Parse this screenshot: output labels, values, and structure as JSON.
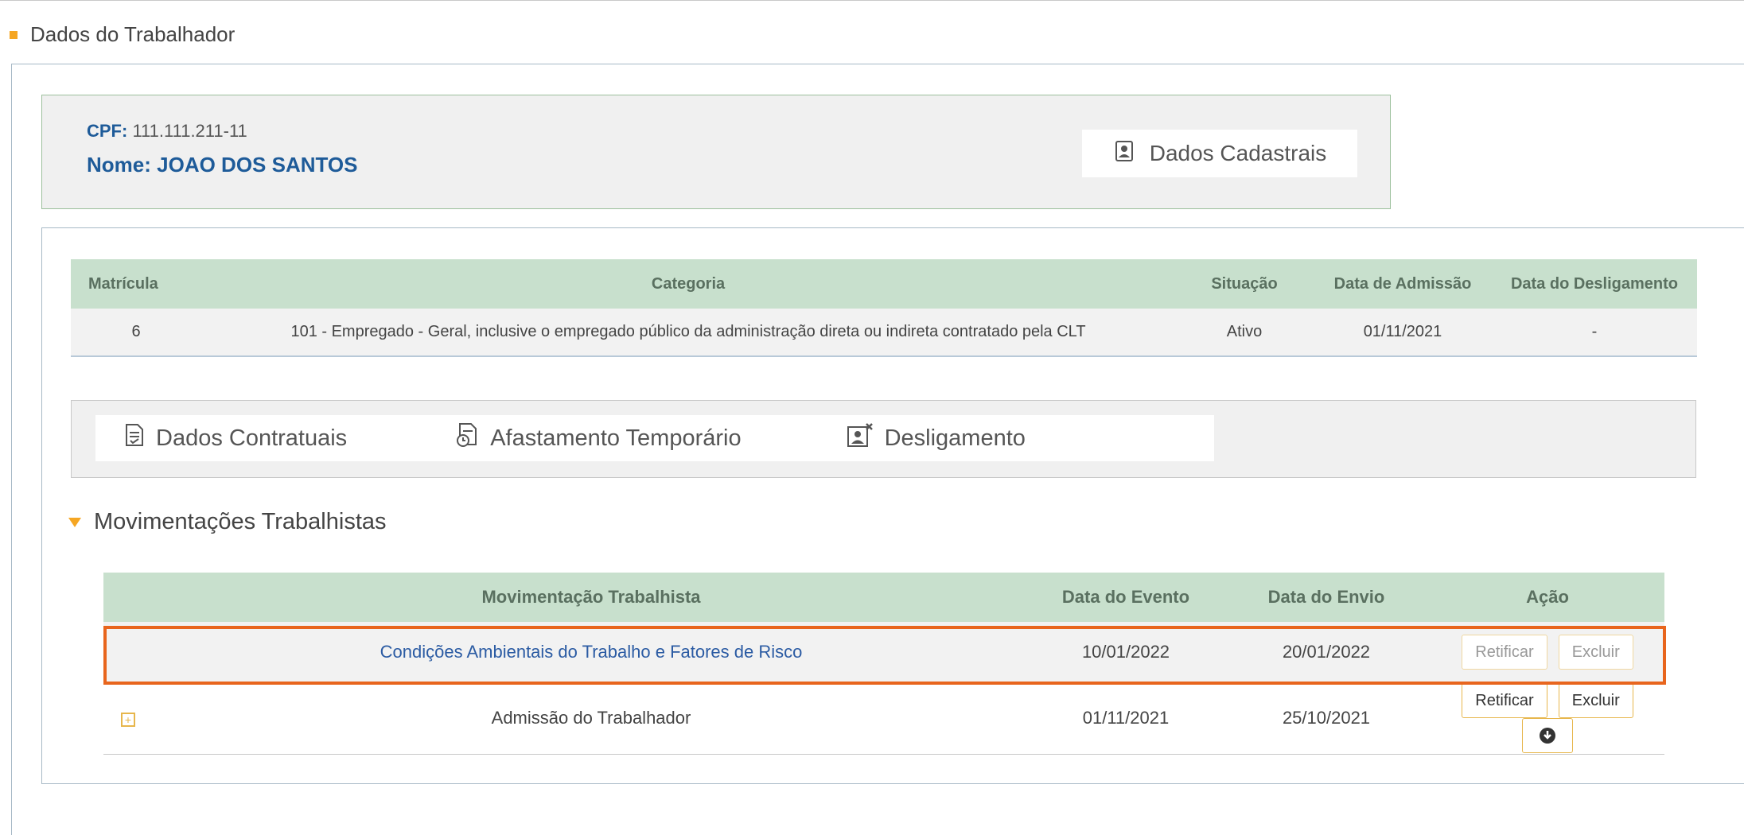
{
  "section": {
    "title": "Dados do Trabalhador"
  },
  "worker": {
    "cpf_label": "CPF:",
    "cpf_value": "111.111.211-11",
    "name_label": "Nome:",
    "name_value": "JOAO DOS SANTOS",
    "dados_cadastrais_label": "Dados Cadastrais"
  },
  "vinculo_table": {
    "headers": [
      "Matrícula",
      "Categoria",
      "Situação",
      "Data de Admissão",
      "Data do Desligamento"
    ],
    "rows": [
      [
        "6",
        "101 - Empregado - Geral, inclusive o empregado público da administração direta ou indireta contratado pela CLT",
        "Ativo",
        "01/11/2021",
        "-"
      ]
    ]
  },
  "tabs": [
    {
      "label": "Dados Contratuais",
      "icon": "contract-document-icon"
    },
    {
      "label": "Afastamento Temporário",
      "icon": "document-clock-icon"
    },
    {
      "label": "Desligamento",
      "icon": "user-remove-icon"
    }
  ],
  "movimentacoes": {
    "title": "Movimentações Trabalhistas",
    "headers": [
      "Movimentação Trabalhista",
      "Data do Evento",
      "Data do Envio",
      "Ação"
    ],
    "rows": [
      {
        "movimentacao": "Condições Ambientais do Trabalho e Fatores de Risco",
        "data_evento": "10/01/2022",
        "data_envio": "20/01/2022",
        "retificar": "Retificar",
        "excluir": "Excluir"
      },
      {
        "movimentacao": "Admissão do Trabalhador",
        "data_evento": "01/11/2021",
        "data_envio": "25/10/2021",
        "retificar": "Retificar",
        "excluir": "Excluir"
      }
    ]
  },
  "colors": {
    "accent": "#f5a623",
    "header_green": "#c8e0cd",
    "link_blue": "#2b5ba3",
    "highlight_orange": "#e8651d"
  }
}
